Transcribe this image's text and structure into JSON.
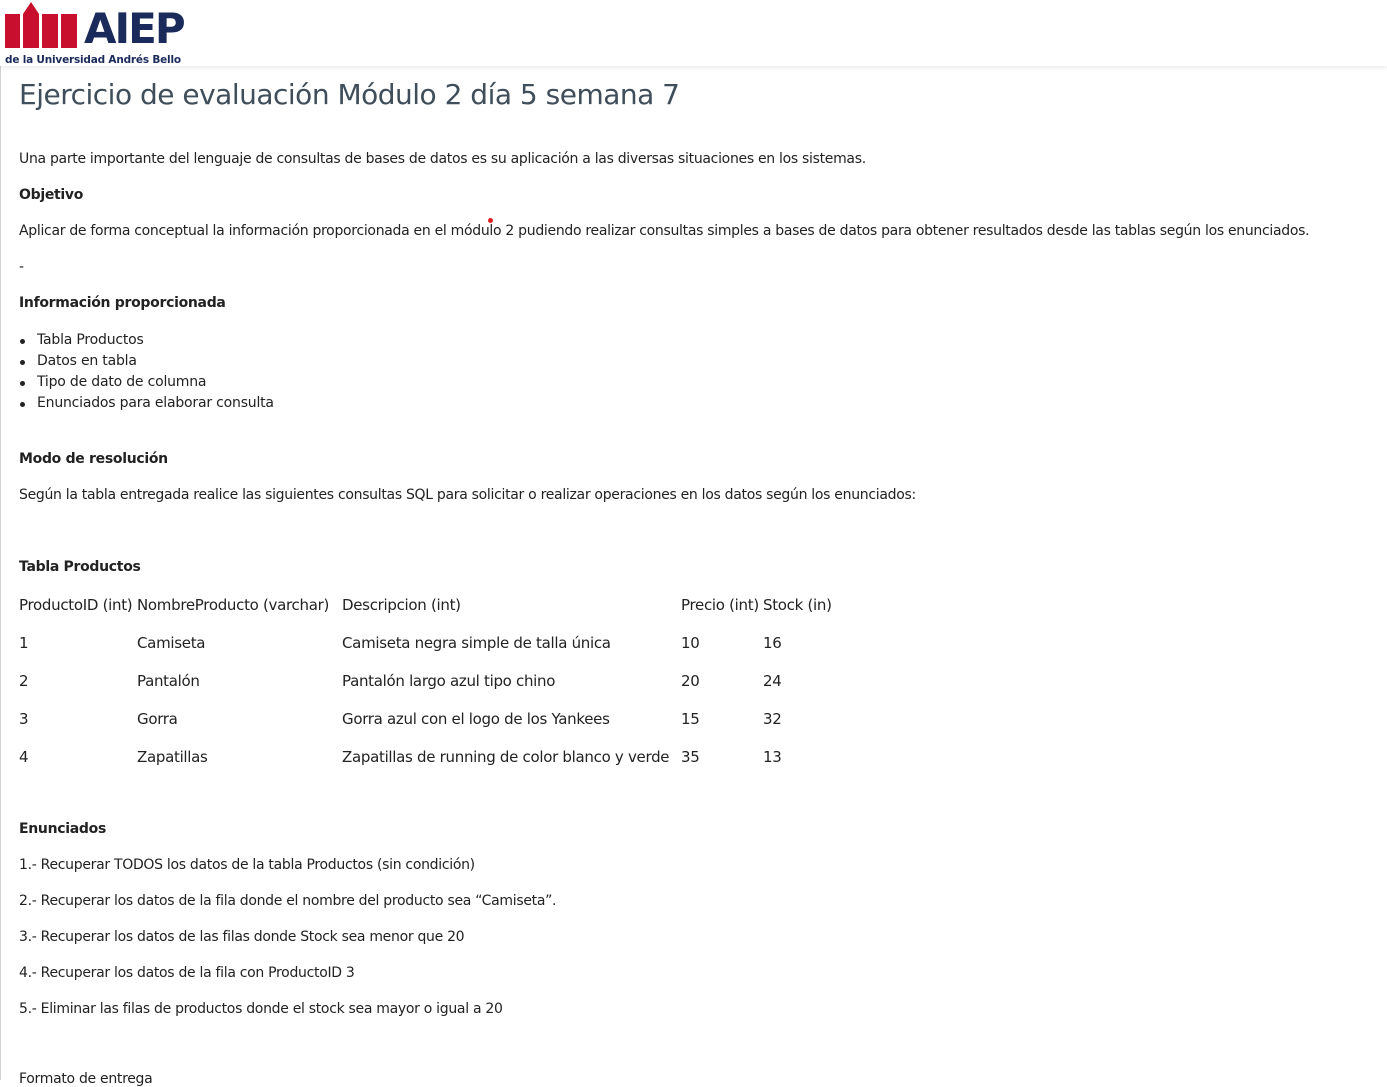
{
  "header": {
    "logo_text": "AIEP",
    "logo_subtitle": "de la Universidad Andrés Bello",
    "brand_colors": {
      "red": "#c8102e",
      "navy": "#1a2a5a"
    }
  },
  "page": {
    "title": "Ejercicio de evaluación Módulo 2 día 5 semana 7",
    "intro": "Una parte importante del lenguaje de consultas de bases de datos es su aplicación a las diversas situaciones en los sistemas.",
    "objetivo_heading": "Objetivo",
    "objetivo_text": "Aplicar de forma conceptual la información proporcionada en el módulo 2 pudiendo realizar consultas simples a bases de datos para obtener resultados desde las tablas según los enunciados.",
    "dash": "-",
    "info_heading": "Información proporcionada",
    "info_items": [
      "Tabla Productos",
      "Datos en tabla",
      "Tipo de dato de columna",
      "Enunciados para elaborar consulta"
    ],
    "modo_heading": "Modo de resolución",
    "modo_text": "Según la tabla entregada realice las siguientes consultas SQL para solicitar o realizar operaciones en los datos según los enunciados:",
    "tabla_heading": "Tabla Productos",
    "table": {
      "headers": [
        "ProductoID (int)",
        "NombreProducto (varchar)",
        "Descripcion (int)",
        "Precio (int)",
        "Stock (in)"
      ],
      "rows": [
        [
          "1",
          "Camiseta",
          "Camiseta negra simple de talla única",
          "10",
          "16"
        ],
        [
          "2",
          "Pantalón",
          "Pantalón largo azul tipo chino",
          "20",
          "24"
        ],
        [
          "3",
          "Gorra",
          "Gorra azul con el logo de los Yankees",
          "15",
          "32"
        ],
        [
          "4",
          "Zapatillas",
          "Zapatillas de running de color blanco y verde",
          "35",
          "13"
        ]
      ]
    },
    "enunciados_heading": "Enunciados",
    "enunciados": [
      "1.- Recuperar TODOS los datos de la tabla Productos (sin condición)",
      "2.- Recuperar los datos de la fila donde  el nombre del producto sea “Camiseta”.",
      "3.- Recuperar los datos de las filas donde Stock sea menor que 20",
      "4.- Recuperar los datos de la fila con ProductoID 3",
      "5.- Eliminar las filas de productos donde el stock sea mayor o igual a 20"
    ],
    "formato_heading": "Formato de entrega"
  }
}
